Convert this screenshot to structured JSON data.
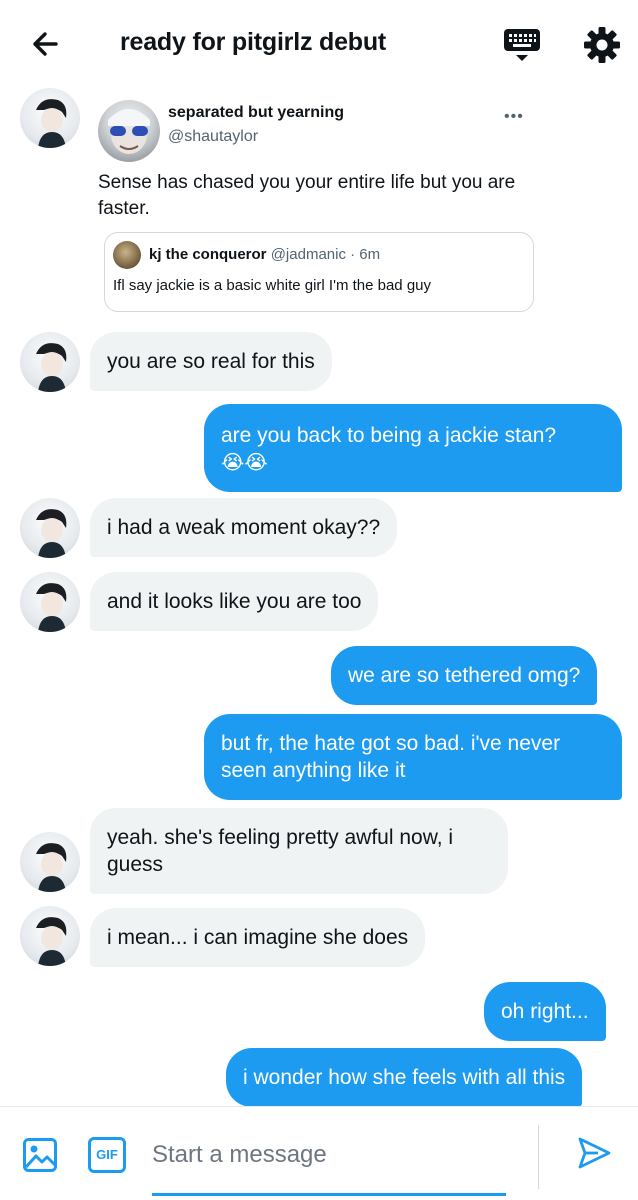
{
  "header": {
    "title": "ready for pitgirlz debut"
  },
  "shared_tweet": {
    "author_name": "separated but yearning",
    "author_handle": "@shautaylor",
    "more": "•••",
    "text": "Sense has chased you your entire life but you are faster.",
    "quoted": {
      "author_name": "kj the conqueror",
      "author_handle": "@jadmanic",
      "time": " · 6m",
      "text": "Ifl say jackie is a basic white girl I'm the bad guy"
    }
  },
  "messages": [
    {
      "from": "them",
      "text": "you are so real for this"
    },
    {
      "from": "me",
      "text": "are you back to being a jackie stan?",
      "emoji": "😭😭"
    },
    {
      "from": "them",
      "text": "i had a weak moment okay??"
    },
    {
      "from": "them",
      "text": "and it looks like you are too"
    },
    {
      "from": "me",
      "text": "we are so tethered omg?"
    },
    {
      "from": "me",
      "line1": "but fr, the hate got so bad. i've never",
      "line2": "seen anything like it"
    },
    {
      "from": "them",
      "line1": "yeah. she's feeling pretty awful now, i",
      "line2": "guess"
    },
    {
      "from": "them",
      "text": "i mean... i can imagine she does"
    },
    {
      "from": "me",
      "text": "oh right..."
    },
    {
      "from": "me",
      "text": "i wonder how she feels with all this"
    }
  ],
  "composer": {
    "gif_label": "GIF",
    "placeholder": "Start a message"
  },
  "colors": {
    "accent": "#1d9bf0",
    "received_bubble": "#eff3f4",
    "text": "#0f1419",
    "secondary_text": "#536471"
  },
  "icons": [
    "back-arrow-icon",
    "keyboard-icon",
    "gear-icon",
    "image-icon",
    "gif-icon",
    "send-icon"
  ]
}
